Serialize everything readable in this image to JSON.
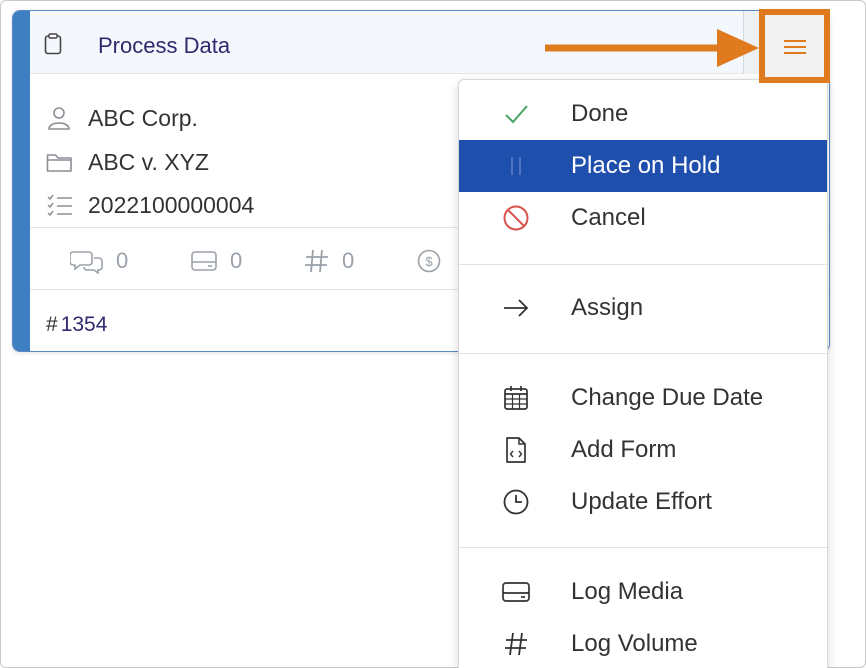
{
  "task_card": {
    "title": "Process Data",
    "client": "ABC Corp.",
    "matter": "ABC v. XYZ",
    "number": "2022100000004",
    "stats": {
      "comments": "0",
      "media": "0",
      "volume": "0"
    },
    "id_prefix": "#",
    "id": "1354"
  },
  "menu": {
    "items": [
      {
        "label": "Done",
        "icon": "check-icon"
      },
      {
        "label": "Place on Hold",
        "icon": "pause-icon",
        "active": true
      },
      {
        "label": "Cancel",
        "icon": "cancel-icon"
      },
      {
        "label": "Assign",
        "icon": "arrow-right-icon"
      },
      {
        "label": "Change Due Date",
        "icon": "calendar-icon"
      },
      {
        "label": "Add Form",
        "icon": "form-file-icon"
      },
      {
        "label": "Update Effort",
        "icon": "clock-icon"
      },
      {
        "label": "Log Media",
        "icon": "media-drive-icon"
      },
      {
        "label": "Log Volume",
        "icon": "hash-icon"
      }
    ]
  },
  "colors": {
    "accent": "#3d7fc0",
    "active_item": "#1f4fad",
    "highlight": "#e07a1f",
    "done_check": "#4aa564",
    "cancel_red": "#d9534f",
    "title_text": "#2e2a6e"
  }
}
